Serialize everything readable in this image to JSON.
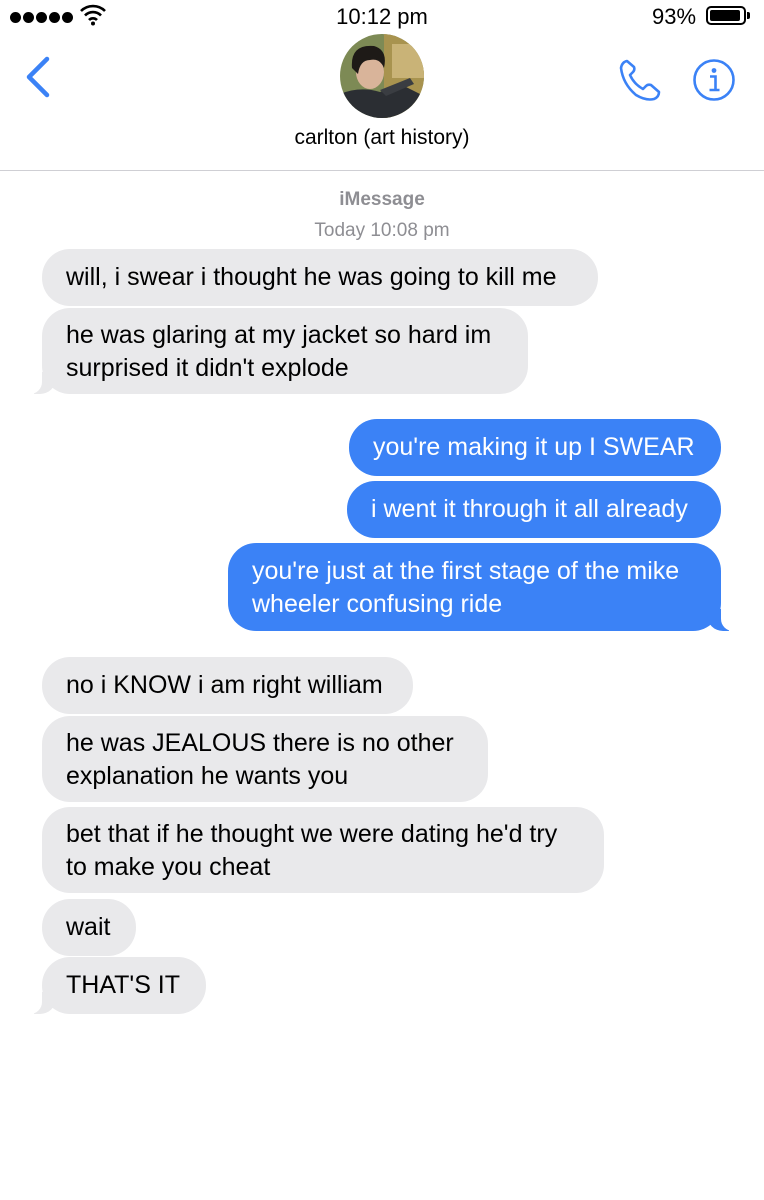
{
  "status_bar": {
    "time": "10:12 pm",
    "battery": "93%"
  },
  "header": {
    "contact_name": "carlton (art history)"
  },
  "thread": {
    "service": "iMessage",
    "timestamp": "Today 10:08 pm"
  },
  "messages": [
    {
      "from": "them",
      "lines": [
        "will, i swear i thought he was going to kill me"
      ]
    },
    {
      "from": "them",
      "lines": [
        "he was glaring at my jacket so hard im",
        "surprised it didn't explode"
      ]
    },
    {
      "from": "me",
      "lines": [
        "you're making it up I SWEAR"
      ]
    },
    {
      "from": "me",
      "lines": [
        "i went it through it all already"
      ]
    },
    {
      "from": "me",
      "lines": [
        "you're just at the first stage of the mike",
        "wheeler confusing ride"
      ]
    },
    {
      "from": "them",
      "lines": [
        "no i KNOW i am right william"
      ]
    },
    {
      "from": "them",
      "lines": [
        "he was JEALOUS there is no other",
        "explanation he wants you"
      ]
    },
    {
      "from": "them",
      "lines": [
        "bet that if he thought we were dating he'd try",
        "to make you cheat"
      ]
    },
    {
      "from": "them",
      "lines": [
        "wait"
      ]
    },
    {
      "from": "them",
      "lines": [
        "THAT'S IT"
      ]
    }
  ],
  "colors": {
    "accent": "#3b82f6",
    "incoming_bubble": "#e9e9eb",
    "meta_text": "#8e8e93"
  },
  "icons": [
    "signal-dots-icon",
    "wifi-icon",
    "battery-icon",
    "back-chevron-icon",
    "phone-icon",
    "info-icon"
  ]
}
